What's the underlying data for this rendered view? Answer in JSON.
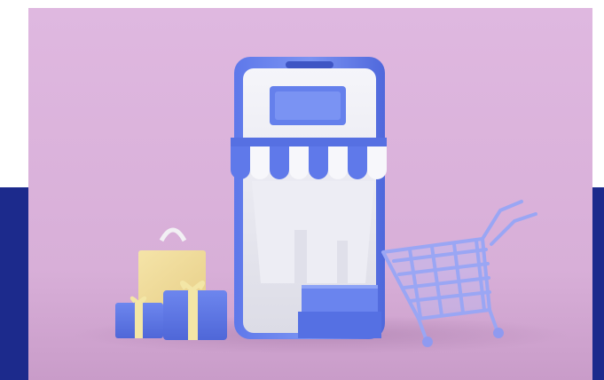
{
  "scene": {
    "backdrop_color": "#dcb4dc",
    "accent_color": "#1c2a8c",
    "icons": [
      "smartphone-icon",
      "storefront-awning-icon",
      "shopping-cart-icon",
      "shopping-bag-icon",
      "gift-box-icon"
    ]
  }
}
